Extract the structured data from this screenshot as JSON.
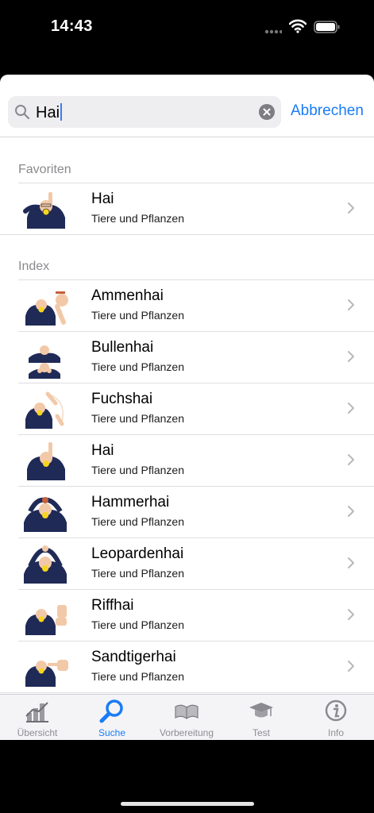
{
  "status": {
    "time": "14:43"
  },
  "search": {
    "value": "Hai",
    "cancel_label": "Abbrechen"
  },
  "sections": {
    "favorites": "Favoriten",
    "index": "Index"
  },
  "favorites": [
    {
      "title": "Hai",
      "subtitle": "Tiere und Pflanzen"
    }
  ],
  "index": [
    {
      "title": "Ammenhai",
      "subtitle": "Tiere und Pflanzen"
    },
    {
      "title": "Bullenhai",
      "subtitle": "Tiere und Pflanzen"
    },
    {
      "title": "Fuchshai",
      "subtitle": "Tiere und Pflanzen"
    },
    {
      "title": "Hai",
      "subtitle": "Tiere und Pflanzen"
    },
    {
      "title": "Hammerhai",
      "subtitle": "Tiere und Pflanzen"
    },
    {
      "title": "Leopardenhai",
      "subtitle": "Tiere und Pflanzen"
    },
    {
      "title": "Riffhai",
      "subtitle": "Tiere und Pflanzen"
    },
    {
      "title": "Sandtigerhai",
      "subtitle": "Tiere und Pflanzen"
    }
  ],
  "tabs": [
    {
      "label": "Übersicht",
      "icon": "chart-icon"
    },
    {
      "label": "Suche",
      "icon": "search-icon",
      "active": true
    },
    {
      "label": "Vorbereitung",
      "icon": "book-icon"
    },
    {
      "label": "Test",
      "icon": "graduation-cap-icon"
    },
    {
      "label": "Info",
      "icon": "info-icon"
    }
  ],
  "colors": {
    "accent": "#1a7cf5",
    "tab_inactive": "#8e8e93"
  }
}
